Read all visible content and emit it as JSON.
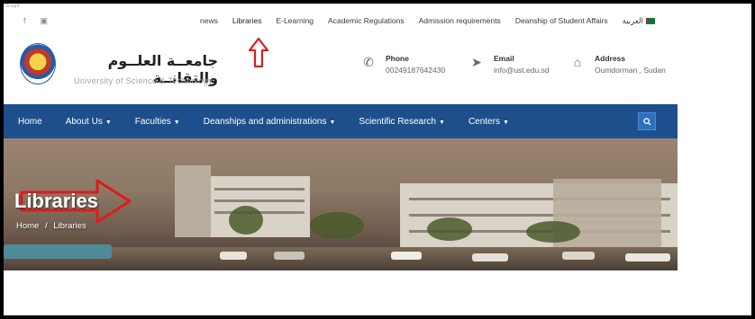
{
  "capture_label": "Snagit",
  "social": [
    {
      "icon": "facebook-icon",
      "glyph": "f"
    },
    {
      "icon": "youtube-icon",
      "glyph": "▣"
    }
  ],
  "top_links": [
    {
      "label": "news"
    },
    {
      "label": "Libraries"
    },
    {
      "label": "E-Learning"
    },
    {
      "label": "Academic Regulations"
    },
    {
      "label": "Admission requirements"
    },
    {
      "label": "Deanship of Student Affairs"
    },
    {
      "label": "العربية"
    }
  ],
  "university": {
    "name_ar": "جامعــة العلــوم والتقانــة",
    "name_en": "University of Science & Technology"
  },
  "contacts": {
    "phone": {
      "label": "Phone",
      "value": "00249187642430"
    },
    "email": {
      "label": "Email",
      "value": "info@ust.edu.sd"
    },
    "address": {
      "label": "Address",
      "value": "Oumdorman , Sudan"
    }
  },
  "nav": [
    {
      "label": "Home"
    },
    {
      "label": "About Us",
      "dropdown": true
    },
    {
      "label": "Faculties",
      "dropdown": true
    },
    {
      "label": "Deanships and administrations",
      "dropdown": true
    },
    {
      "label": "Scientific Research",
      "dropdown": true
    },
    {
      "label": "Centers",
      "dropdown": true
    }
  ],
  "hero": {
    "title": "Libraries",
    "breadcrumb_home": "Home",
    "breadcrumb_sep": "/",
    "breadcrumb_current": "Libraries"
  },
  "colors": {
    "nav_bg": "#1d4f8d",
    "annotation_red": "#e01b1b"
  }
}
